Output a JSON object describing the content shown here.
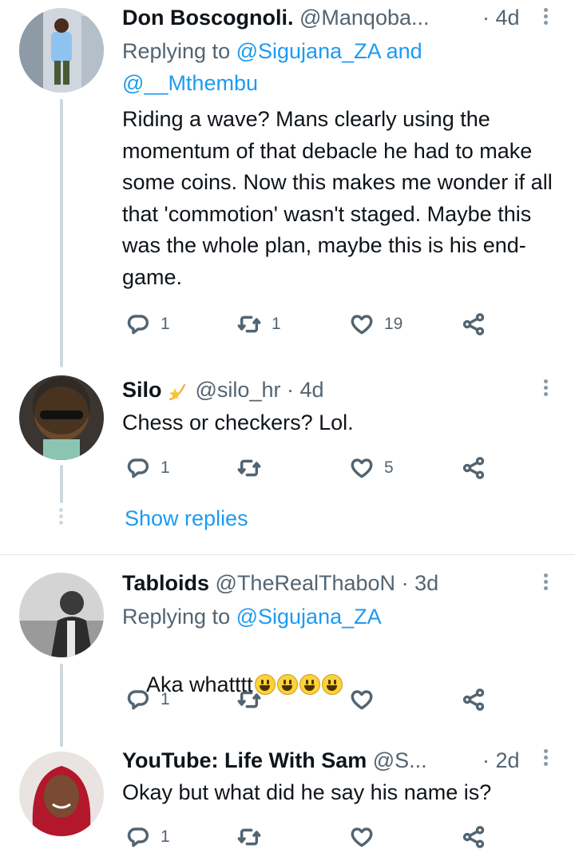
{
  "tweets": [
    {
      "name": "Don Boscognoli.",
      "handle": "@Manqoba...",
      "time": "· 4d",
      "reply_label": "Replying to",
      "reply_mentions_line1": "@Sigujana_ZA and",
      "reply_mentions_line2": "@__Mthembu",
      "text": "Riding a wave? Mans clearly using the momentum of that debacle he had to make some coins. Now this makes me wonder if all that 'commotion' wasn't staged. Maybe this was the whole plan, maybe this is his end-game.",
      "replies": "1",
      "retweets": "1",
      "likes": "19"
    },
    {
      "name": "Silo",
      "handle": "@silo_hr",
      "time": "· 4d",
      "text": "Chess or checkers? Lol.",
      "replies": "1",
      "retweets": "",
      "likes": "5"
    },
    {
      "name": "Tabloids",
      "handle": "@TheRealThaboN",
      "time": "· 3d",
      "reply_label": "Replying to",
      "reply_mentions_line1": "@Sigujana_ZA",
      "text": "Aka whatttt",
      "replies": "1",
      "retweets": "",
      "likes": ""
    },
    {
      "name": "YouTube: Life With Sam",
      "handle": "@S...",
      "time": "· 2d",
      "text": "Okay but what did he say his name is?",
      "replies": "1"
    }
  ],
  "show_replies_label": "Show replies",
  "icons": {
    "reply": "reply-icon",
    "retweet": "retweet-icon",
    "like": "heart-icon",
    "share": "share-icon",
    "more": "more-vertical-icon",
    "sparkle": "sparkle-icon",
    "emoji": "grinning-face-emoji"
  },
  "colors": {
    "link": "#1d9bf0",
    "secondary_text": "#536471",
    "thread_line": "#cfd9de"
  }
}
